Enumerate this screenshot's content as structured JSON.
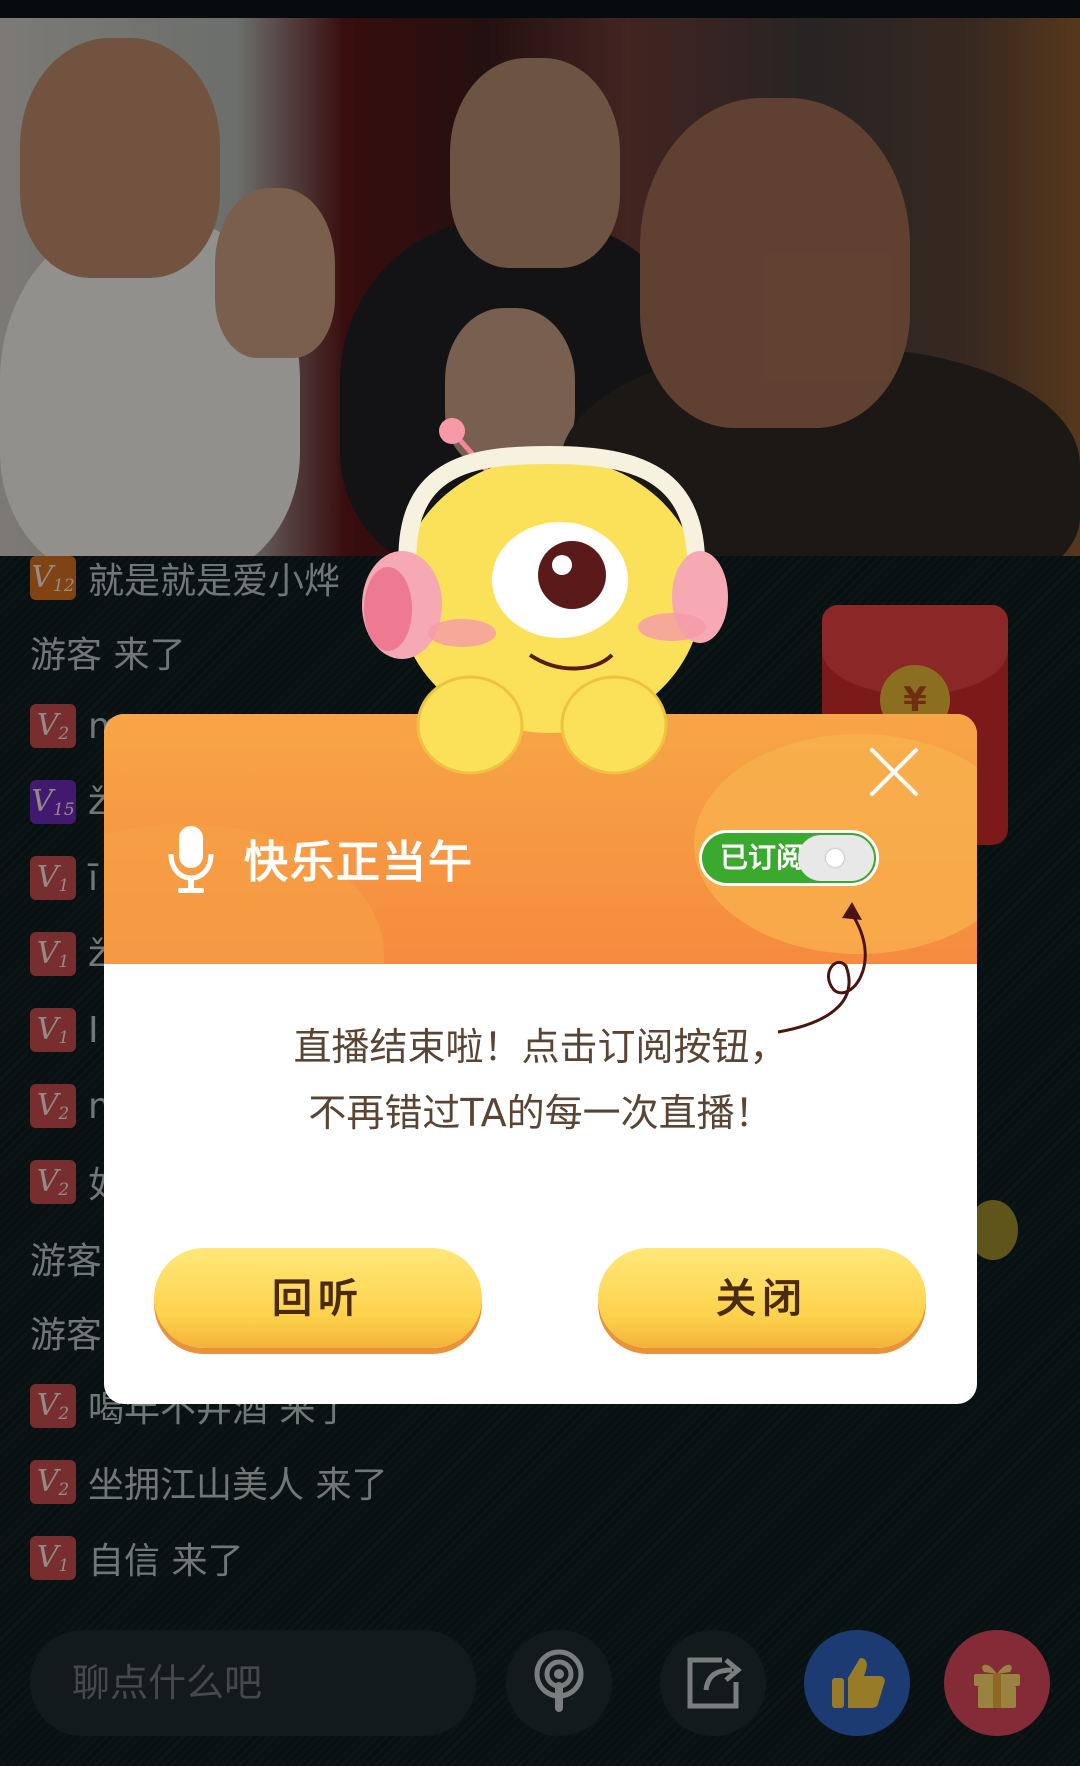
{
  "chat": [
    {
      "level": "12",
      "badge_color": "orange",
      "text": "就是就是爱小烨"
    },
    {
      "level": "",
      "badge_color": "",
      "text": "游客 来了"
    },
    {
      "level": "2",
      "badge_color": "red",
      "text": "m"
    },
    {
      "level": "15",
      "badge_color": "purple",
      "text": "ž"
    },
    {
      "level": "1",
      "badge_color": "red",
      "text": "ī"
    },
    {
      "level": "1",
      "badge_color": "red",
      "text": "ž"
    },
    {
      "level": "1",
      "badge_color": "red",
      "text": "I"
    },
    {
      "level": "2",
      "badge_color": "red",
      "text": "m"
    },
    {
      "level": "2",
      "badge_color": "red",
      "text": "如"
    },
    {
      "level": "",
      "badge_color": "",
      "text": "游客"
    },
    {
      "level": "",
      "badge_color": "",
      "text": "游客"
    },
    {
      "level": "2",
      "badge_color": "red",
      "text": "喝年不井酒 来了"
    },
    {
      "level": "2",
      "badge_color": "red",
      "text": "坐拥江山美人 来了"
    },
    {
      "level": "1",
      "badge_color": "red",
      "text": "自信 来了"
    }
  ],
  "dialog": {
    "title": "快乐正当午",
    "subscribe_label": "已订阅",
    "message_line1": "直播结束啦！点击订阅按钮，",
    "message_line2": "不再错过TA的每一次直播！",
    "replay_button": "回听",
    "close_button": "关闭"
  },
  "redpacket": {
    "symbol": "¥"
  },
  "bottom": {
    "input_placeholder": "聊点什么吧"
  },
  "badge_prefix": "V",
  "colors": {
    "accent_orange": "#f68b3f",
    "button_yellow": "#fdd14a",
    "toggle_green": "#3aa92d"
  }
}
